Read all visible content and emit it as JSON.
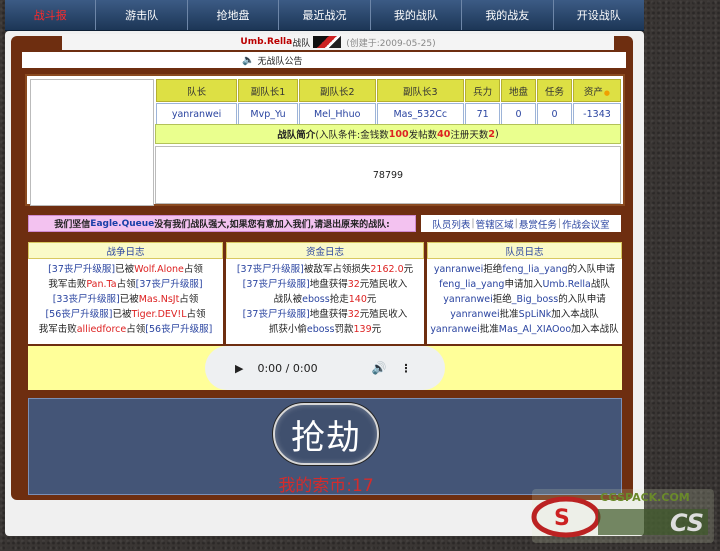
{
  "nav": {
    "items": [
      {
        "label": "战斗报",
        "active": true
      },
      {
        "label": "游击队"
      },
      {
        "label": "抢地盘"
      },
      {
        "label": "最近战况"
      },
      {
        "label": "我的战队"
      },
      {
        "label": "我的战友"
      },
      {
        "label": "开设战队"
      }
    ]
  },
  "team": {
    "name": "Umb.Rella",
    "name_suffix": "战队",
    "created": "(创建于:2009-05-25)"
  },
  "notice": {
    "text": "无战队公告",
    "icon": "speaker-icon"
  },
  "stats": {
    "headers": [
      "队长",
      "副队长1",
      "副队长2",
      "副队长3",
      "兵力",
      "地盘",
      "任务",
      "资产"
    ],
    "values": [
      "yanranwei",
      "Mvp_Yu",
      "Mel_Hhuo",
      "Mas_532Cc",
      "71",
      "0",
      "0",
      "-1343"
    ]
  },
  "intro": {
    "title": "战队简介",
    "pre": "(入队条件:金钱数",
    "money": "100",
    "mid": " 发帖数",
    "posts": "40",
    "post_suffix": " 注册天数",
    "days": "2",
    "end": ")"
  },
  "description": "78799",
  "alert": {
    "pre": "我们坚信",
    "highlight": "Eagle.Queue",
    "post": "没有我们战队强大,如果您有意加入我们,请退出原来的战队:"
  },
  "links": [
    "队员列表",
    "管辖区域",
    "悬赏任务",
    "作战会议室"
  ],
  "logs": {
    "war": {
      "title": "战争日志",
      "lines": [
        [
          {
            "t": "[37丧尸升级服]",
            "c": "blue"
          },
          {
            "t": "已被",
            "c": "dark"
          },
          {
            "t": "Wolf.Alone",
            "c": "red"
          },
          {
            "t": "占领",
            "c": "dark"
          }
        ],
        [
          {
            "t": "我军击败",
            "c": "dark"
          },
          {
            "t": "Pan.Ta",
            "c": "red"
          },
          {
            "t": "占领",
            "c": "dark"
          },
          {
            "t": "[37丧尸升级服]",
            "c": "blue"
          }
        ],
        [
          {
            "t": "[33丧尸升级服]",
            "c": "blue"
          },
          {
            "t": "已被",
            "c": "dark"
          },
          {
            "t": "Mas.NsJt",
            "c": "red"
          },
          {
            "t": "占领",
            "c": "dark"
          }
        ],
        [
          {
            "t": "[56丧尸升级服]",
            "c": "blue"
          },
          {
            "t": "已被",
            "c": "dark"
          },
          {
            "t": "Tiger.DEV!L",
            "c": "red"
          },
          {
            "t": "占领",
            "c": "dark"
          }
        ],
        [
          {
            "t": "我军击败",
            "c": "dark"
          },
          {
            "t": "alliedforce",
            "c": "red"
          },
          {
            "t": "占领",
            "c": "dark"
          },
          {
            "t": "[56丧尸升级服]",
            "c": "blue"
          }
        ]
      ]
    },
    "funds": {
      "title": "资金日志",
      "lines": [
        [
          {
            "t": "[37丧尸升级服]",
            "c": "blue"
          },
          {
            "t": "被敌军占领损失",
            "c": "dark"
          },
          {
            "t": "2162.0",
            "c": "red"
          },
          {
            "t": "元",
            "c": "dark"
          }
        ],
        [
          {
            "t": "[37丧尸升级服]",
            "c": "blue"
          },
          {
            "t": "地盘获得",
            "c": "dark"
          },
          {
            "t": "32",
            "c": "red"
          },
          {
            "t": "元殖民收入",
            "c": "dark"
          }
        ],
        [
          {
            "t": "战队被",
            "c": "dark"
          },
          {
            "t": "eboss",
            "c": "blue"
          },
          {
            "t": "抢走",
            "c": "dark"
          },
          {
            "t": "140",
            "c": "red"
          },
          {
            "t": "元",
            "c": "dark"
          }
        ],
        [
          {
            "t": "[37丧尸升级服]",
            "c": "blue"
          },
          {
            "t": "地盘获得",
            "c": "dark"
          },
          {
            "t": "32",
            "c": "red"
          },
          {
            "t": "元殖民收入",
            "c": "dark"
          }
        ],
        [
          {
            "t": "抓获小偷",
            "c": "dark"
          },
          {
            "t": "eboss",
            "c": "blue"
          },
          {
            "t": "罚款",
            "c": "dark"
          },
          {
            "t": "139",
            "c": "red"
          },
          {
            "t": "元",
            "c": "dark"
          }
        ]
      ]
    },
    "members": {
      "title": "队员日志",
      "lines": [
        [
          {
            "t": "yanranwei",
            "c": "blue"
          },
          {
            "t": "拒绝",
            "c": "dark"
          },
          {
            "t": "feng_lia_yang",
            "c": "blue"
          },
          {
            "t": "的入队申请",
            "c": "dark"
          }
        ],
        [
          {
            "t": "feng_lia_yang",
            "c": "blue"
          },
          {
            "t": "申请加入",
            "c": "dark"
          },
          {
            "t": "Umb.Rella",
            "c": "blue"
          },
          {
            "t": "战队",
            "c": "dark"
          }
        ],
        [
          {
            "t": "yanranwei",
            "c": "blue"
          },
          {
            "t": "拒绝",
            "c": "dark"
          },
          {
            "t": "_Big_boss",
            "c": "blue"
          },
          {
            "t": "的入队申请",
            "c": "dark"
          }
        ],
        [
          {
            "t": "yanranwei",
            "c": "blue"
          },
          {
            "t": "批准",
            "c": "dark"
          },
          {
            "t": "SpLiNk",
            "c": "blue"
          },
          {
            "t": "加入本战队",
            "c": "dark"
          }
        ],
        [
          {
            "t": "yanranwei",
            "c": "blue"
          },
          {
            "t": "批准",
            "c": "dark"
          },
          {
            "t": "Mas_Al_XIAOoo",
            "c": "blue"
          },
          {
            "t": "加入本战队",
            "c": "dark"
          }
        ]
      ]
    }
  },
  "audio": {
    "time": "0:00 / 0:00"
  },
  "action": {
    "rob_label": "抢劫",
    "coins_label": "我的索币:17"
  },
  "watermark": {
    "text_top": "CGSPACK.COM",
    "text_logo": "CS"
  }
}
